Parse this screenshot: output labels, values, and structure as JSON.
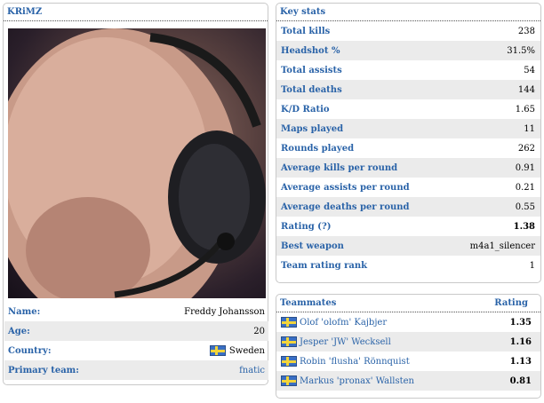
{
  "profile": {
    "nickname": "KRiMZ",
    "fields": [
      {
        "label": "Name:",
        "value": "Freddy Johansson",
        "flag": false,
        "link": false
      },
      {
        "label": "Age:",
        "value": "20",
        "flag": false,
        "link": false
      },
      {
        "label": "Country:",
        "value": "Sweden",
        "flag": true,
        "link": false
      },
      {
        "label": "Primary team:",
        "value": "fnatic",
        "flag": false,
        "link": true
      }
    ]
  },
  "key_stats": {
    "title": "Key stats",
    "rows": [
      {
        "label": "Total kills",
        "value": "238"
      },
      {
        "label": "Headshot %",
        "value": "31.5%"
      },
      {
        "label": "Total assists",
        "value": "54"
      },
      {
        "label": "Total deaths",
        "value": "144"
      },
      {
        "label": "K/D Ratio",
        "value": "1.65"
      },
      {
        "label": "Maps played",
        "value": "11"
      },
      {
        "label": "Rounds played",
        "value": "262"
      },
      {
        "label": "Average kills per round",
        "value": "0.91"
      },
      {
        "label": "Average assists per round",
        "value": "0.21"
      },
      {
        "label": "Average deaths per round",
        "value": "0.55"
      },
      {
        "label": "Rating (?)",
        "value": "1.38"
      },
      {
        "label": "Best weapon",
        "value": "m4a1_silencer"
      },
      {
        "label": "Team rating rank",
        "value": "1"
      }
    ]
  },
  "teammates": {
    "title": "Teammates",
    "rating_header": "Rating",
    "rows": [
      {
        "name": "Olof 'olofm' Kajbjer",
        "rating": "1.35"
      },
      {
        "name": "Jesper 'JW' Wecksell",
        "rating": "1.16"
      },
      {
        "name": "Robin 'flusha' Rönnquist",
        "rating": "1.13"
      },
      {
        "name": "Markus 'pronax' Wallsten",
        "rating": "0.81"
      }
    ]
  },
  "colors": {
    "link": "#2a63a8",
    "stripe": "#ebebeb",
    "flag_blue": "#3a6fc4",
    "flag_yellow": "#f2d43a"
  },
  "icons": {
    "country_flag": "sweden-flag-icon"
  }
}
